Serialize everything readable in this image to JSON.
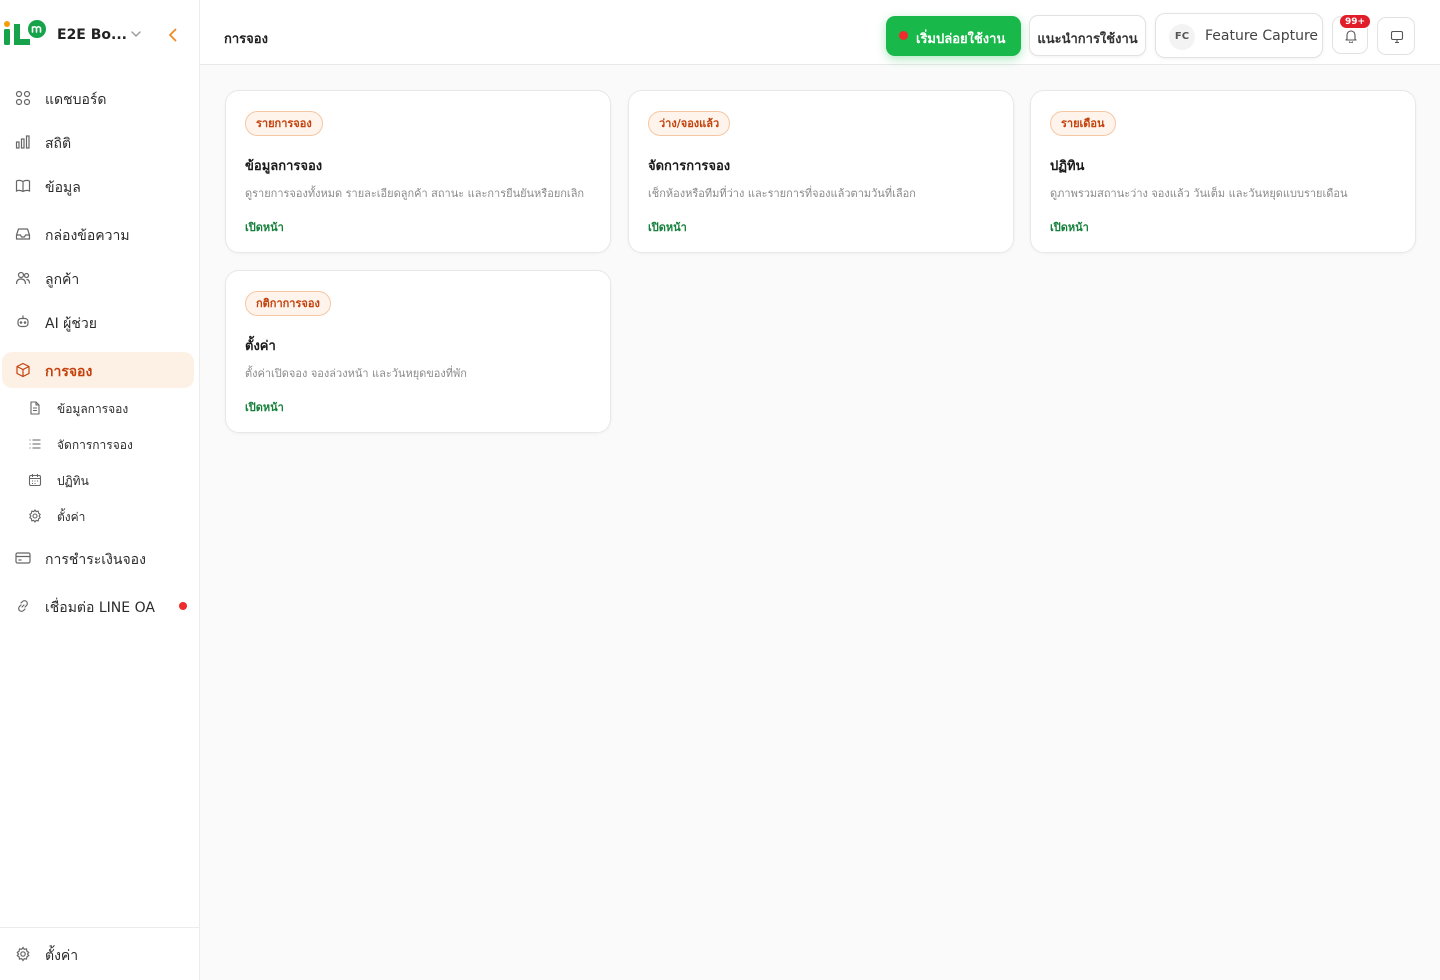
{
  "brand": {
    "name": "E2E Bo..."
  },
  "colors": {
    "accent": "#c2410c",
    "accent_bg": "#fdf1e6",
    "primary_green": "#18b84a",
    "link_green": "#16803c",
    "alert_red": "#ef2b2b"
  },
  "sidebar": {
    "items": [
      {
        "label": "แดชบอร์ด",
        "icon": "grid-icon"
      },
      {
        "label": "สถิติ",
        "icon": "bar-chart-icon"
      },
      {
        "label": "ข้อมูล",
        "icon": "book-icon"
      },
      {
        "label": "กล่องข้อความ",
        "icon": "inbox-icon"
      },
      {
        "label": "ลูกค้า",
        "icon": "users-icon"
      },
      {
        "label": "AI ผู้ช่วย",
        "icon": "bot-icon"
      },
      {
        "label": "การจอง",
        "icon": "box-icon",
        "active": true
      },
      {
        "label": "การชำระเงินจอง",
        "icon": "credit-card-icon"
      },
      {
        "label": "เชื่อมต่อ LINE OA",
        "icon": "link-icon"
      }
    ],
    "sub_items": [
      {
        "label": "ข้อมูลการจอง",
        "icon": "document-icon"
      },
      {
        "label": "จัดการการจอง",
        "icon": "list-icon"
      },
      {
        "label": "ปฏิทิน",
        "icon": "calendar-icon"
      },
      {
        "label": "ตั้งค่า",
        "icon": "gear-icon"
      }
    ],
    "footer": {
      "label": "ตั้งค่า",
      "icon": "gear-icon"
    }
  },
  "header": {
    "title": "การจอง",
    "start_button": "เริ่มปล่อยใช้งาน",
    "guide_button": "แนะนำการใช้งาน",
    "user": {
      "initials": "FC",
      "name": "Feature Capture"
    },
    "notifications_badge": "99+"
  },
  "cards": [
    {
      "tag": "รายการจอง",
      "title": "ข้อมูลการจอง",
      "desc": "ดูรายการจองทั้งหมด รายละเอียดลูกค้า สถานะ และการยืนยันหรือยกเลิก",
      "link": "เปิดหน้า"
    },
    {
      "tag": "ว่าง/จองแล้ว",
      "title": "จัดการการจอง",
      "desc": "เช็กห้องหรือทีมที่ว่าง และรายการที่จองแล้วตามวันที่เลือก",
      "link": "เปิดหน้า"
    },
    {
      "tag": "รายเดือน",
      "title": "ปฏิทิน",
      "desc": "ดูภาพรวมสถานะว่าง จองแล้ว วันเต็ม และวันหยุดแบบรายเดือน",
      "link": "เปิดหน้า"
    },
    {
      "tag": "กติกาการจอง",
      "title": "ตั้งค่า",
      "desc": "ตั้งค่าเปิดจอง จองล่วงหน้า และวันหยุดของที่พัก",
      "link": "เปิดหน้า"
    }
  ]
}
